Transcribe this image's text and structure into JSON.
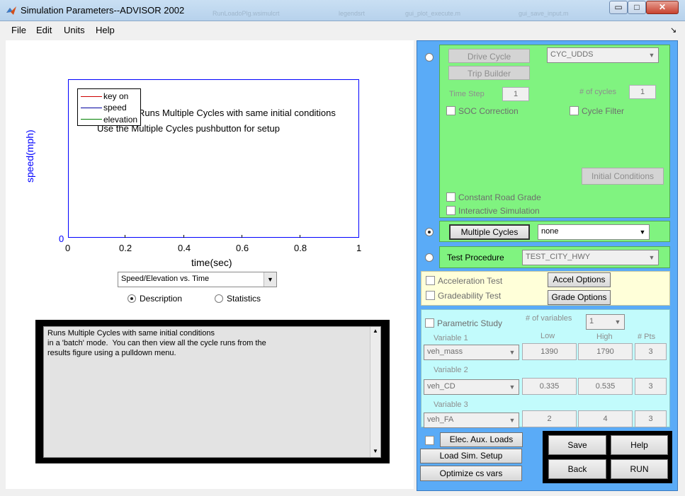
{
  "window": {
    "title": "Simulation Parameters--ADVISOR 2002",
    "ghost_tabs": [
      "RunLoadoPlg.wsimulcrt",
      "legendsrt",
      "gui_plot_execute.m",
      "gui_save_input.m"
    ],
    "btn_min": "▭",
    "btn_max": "□",
    "btn_close": "✕"
  },
  "menu": {
    "items": [
      "File",
      "Edit",
      "Units",
      "Help"
    ],
    "arrow": "↘"
  },
  "plot": {
    "legend": [
      {
        "label": "key on",
        "color": "#cc0000"
      },
      {
        "label": "speed",
        "color": "#0000a0"
      },
      {
        "label": "elevation",
        "color": "#008000"
      }
    ],
    "message_line1": "Runs Multiple Cycles with same initial conditions",
    "message_line2": "Use the Multiple Cycles pushbutton for setup",
    "ylabel": "speed(mph)",
    "xlabel": "time(sec)",
    "y_ticks": [
      "0"
    ],
    "x_ticks": [
      "0",
      "0.2",
      "0.4",
      "0.6",
      "0.8",
      "1"
    ],
    "view_select": "Speed/Elevation vs. Time",
    "radio_description": "Description",
    "radio_statistics": "Statistics"
  },
  "description": "Runs Multiple Cycles with same initial conditions\nin a 'batch' mode.  You can then view all the cycle runs from the\nresults figure using a pulldown menu.",
  "drive": {
    "drive_cycle_btn": "Drive Cycle",
    "cycle_select": "CYC_UDDS",
    "trip_builder_btn": "Trip Builder",
    "time_step_label": "Time Step",
    "time_step_value": "1",
    "num_cycles_label": "# of cycles",
    "num_cycles_value": "1",
    "soc_correction": "SOC Correction",
    "cycle_filter": "Cycle Filter",
    "initial_conditions_btn": "Initial Conditions",
    "constant_road_grade": "Constant Road Grade",
    "interactive_simulation": "Interactive Simulation"
  },
  "multi": {
    "btn": "Multiple Cycles",
    "select": "none"
  },
  "test": {
    "label": "Test Procedure",
    "select": "TEST_CITY_HWY"
  },
  "accel": {
    "accel_test": "Acceleration Test",
    "accel_options_btn": "Accel Options",
    "grade_test": "Gradeability Test",
    "grade_options_btn": "Grade Options"
  },
  "parametric": {
    "label": "Parametric Study",
    "num_vars_label": "# of variables",
    "num_vars_value": "1",
    "col_low": "Low",
    "col_high": "High",
    "col_pts": "# Pts",
    "variables": [
      {
        "label": "Variable 1",
        "name": "veh_mass",
        "low": "1390",
        "high": "1790",
        "pts": "3"
      },
      {
        "label": "Variable 2",
        "name": "veh_CD",
        "low": "0.335",
        "high": "0.535",
        "pts": "3"
      },
      {
        "label": "Variable 3",
        "name": "veh_FA",
        "low": "2",
        "high": "4",
        "pts": "3"
      }
    ]
  },
  "bottom": {
    "elec_aux_btn": "Elec. Aux. Loads",
    "load_setup_btn": "Load Sim. Setup",
    "optimize_btn": "Optimize cs vars",
    "save_btn": "Save",
    "help_btn": "Help",
    "back_btn": "Back",
    "run_btn": "RUN"
  }
}
